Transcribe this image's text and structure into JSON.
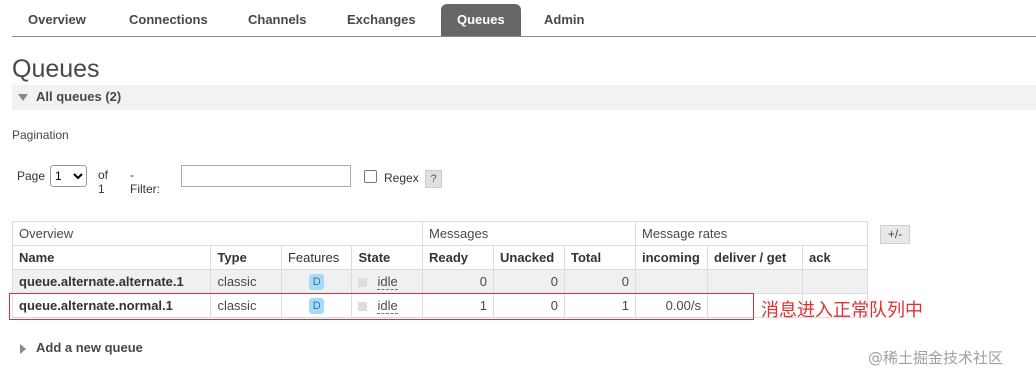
{
  "nav": {
    "tabs": [
      {
        "label": "Overview"
      },
      {
        "label": "Connections"
      },
      {
        "label": "Channels"
      },
      {
        "label": "Exchanges"
      },
      {
        "label": "Queues",
        "active": true
      },
      {
        "label": "Admin"
      }
    ]
  },
  "page": {
    "title": "Queues",
    "section_label": "All queues (2)",
    "pagination_label": "Pagination",
    "add_queue_label": "Add a new queue",
    "annotation": "消息进入正常队列中",
    "watermark": "@稀土掘金技术社区"
  },
  "pagination": {
    "page_label": "Page",
    "page_value": "1",
    "of_label": "of 1",
    "filter_label": "- Filter:",
    "filter_value": "",
    "regex_label": "Regex",
    "regex_checked": false,
    "help_label": "?"
  },
  "table": {
    "groups": {
      "overview": "Overview",
      "messages": "Messages",
      "rates": "Message rates"
    },
    "plus_minus": "+/-",
    "columns": {
      "name": "Name",
      "type": "Type",
      "features": "Features",
      "state": "State",
      "ready": "Ready",
      "unacked": "Unacked",
      "total": "Total",
      "incoming": "incoming",
      "deliver": "deliver / get",
      "ack": "ack"
    },
    "rows": [
      {
        "name": "queue.alternate.alternate.1",
        "type": "classic",
        "feature": "D",
        "state": "idle",
        "ready": "0",
        "unacked": "0",
        "total": "0",
        "incoming": "",
        "deliver": "",
        "ack": ""
      },
      {
        "name": "queue.alternate.normal.1",
        "type": "classic",
        "feature": "D",
        "state": "idle",
        "ready": "1",
        "unacked": "0",
        "total": "1",
        "incoming": "0.00/s",
        "deliver": "",
        "ack": ""
      }
    ]
  },
  "colors": {
    "accent_tab": "#666666",
    "feature_badge": "#a5dbf7",
    "annotation": "#e03030"
  }
}
